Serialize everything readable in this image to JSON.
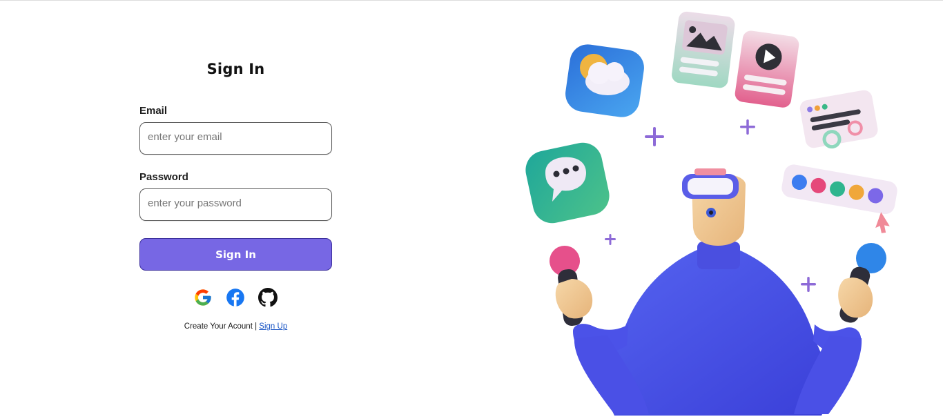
{
  "form": {
    "title": "Sign In",
    "email_label": "Email",
    "email_placeholder": "enter your email",
    "password_label": "Password",
    "password_placeholder": "enter your password",
    "submit_label": "Sign In"
  },
  "social": [
    {
      "icon": "google-icon"
    },
    {
      "icon": "facebook-icon"
    },
    {
      "icon": "github-icon"
    }
  ],
  "footer": {
    "prompt": "Create Your Acount",
    "separator": "|",
    "signup_link": "Sign Up"
  },
  "colors": {
    "accent": "#7767e4",
    "accent_border": "#3c2f9c",
    "link": "#1a55c5"
  }
}
